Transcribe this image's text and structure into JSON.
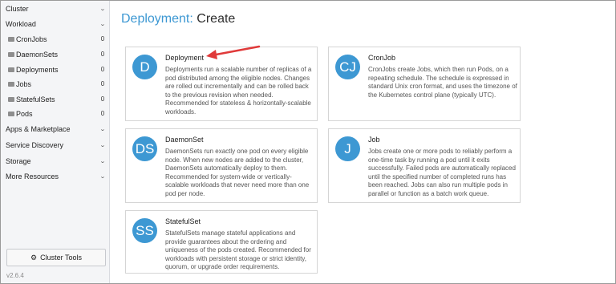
{
  "sidebar": {
    "sections": [
      {
        "label": "Cluster",
        "chevron": "⌄"
      },
      {
        "label": "Workload",
        "chevron": "⌄"
      },
      {
        "label": "Apps & Marketplace",
        "chevron": "⌄"
      },
      {
        "label": "Service Discovery",
        "chevron": "⌄"
      },
      {
        "label": "Storage",
        "chevron": "⌄"
      },
      {
        "label": "More Resources",
        "chevron": "⌄"
      }
    ],
    "workload_items": [
      {
        "label": "CronJobs",
        "count": "0"
      },
      {
        "label": "DaemonSets",
        "count": "0"
      },
      {
        "label": "Deployments",
        "count": "0"
      },
      {
        "label": "Jobs",
        "count": "0"
      },
      {
        "label": "StatefulSets",
        "count": "0"
      },
      {
        "label": "Pods",
        "count": "0"
      }
    ],
    "cluster_tools_label": "Cluster Tools",
    "gear_icon": "gear-icon",
    "version": "v2.6.4"
  },
  "page": {
    "title_accent": "Deployment:",
    "title_rest": "Create"
  },
  "cards": [
    {
      "badge": "D",
      "name": "Deployment",
      "description": "Deployments run a scalable number of replicas of a pod distributed among the eligible nodes. Changes are rolled out incrementally and can be rolled back to the previous revision when needed. Recommended for stateless & horizontally-scalable workloads."
    },
    {
      "badge": "CJ",
      "name": "CronJob",
      "description": "CronJobs create Jobs, which then run Pods, on a repeating schedule. The schedule is expressed in standard Unix cron format, and uses the timezone of the Kubernetes control plane (typically UTC)."
    },
    {
      "badge": "DS",
      "name": "DaemonSet",
      "description": "DaemonSets run exactly one pod on every eligible node. When new nodes are added to the cluster, DaemonSets automatically deploy to them. Recommended for system-wide or vertically-scalable workloads that never need more than one pod per node."
    },
    {
      "badge": "J",
      "name": "Job",
      "description": "Jobs create one or more pods to reliably perform a one-time task by running a pod until it exits successfully. Failed pods are automatically replaced until the specified number of completed runs has been reached. Jobs can also run multiple pods in parallel or function as a batch work queue."
    },
    {
      "badge": "SS",
      "name": "StatefulSet",
      "description": "StatefulSets manage stateful applications and provide guarantees about the ordering and uniqueness of the pods created. Recommended for workloads with persistent storage or strict identity, quorum, or upgrade order requirements."
    }
  ],
  "colors": {
    "accent": "#3d98d3",
    "annotation_arrow": "#e03a3a"
  }
}
